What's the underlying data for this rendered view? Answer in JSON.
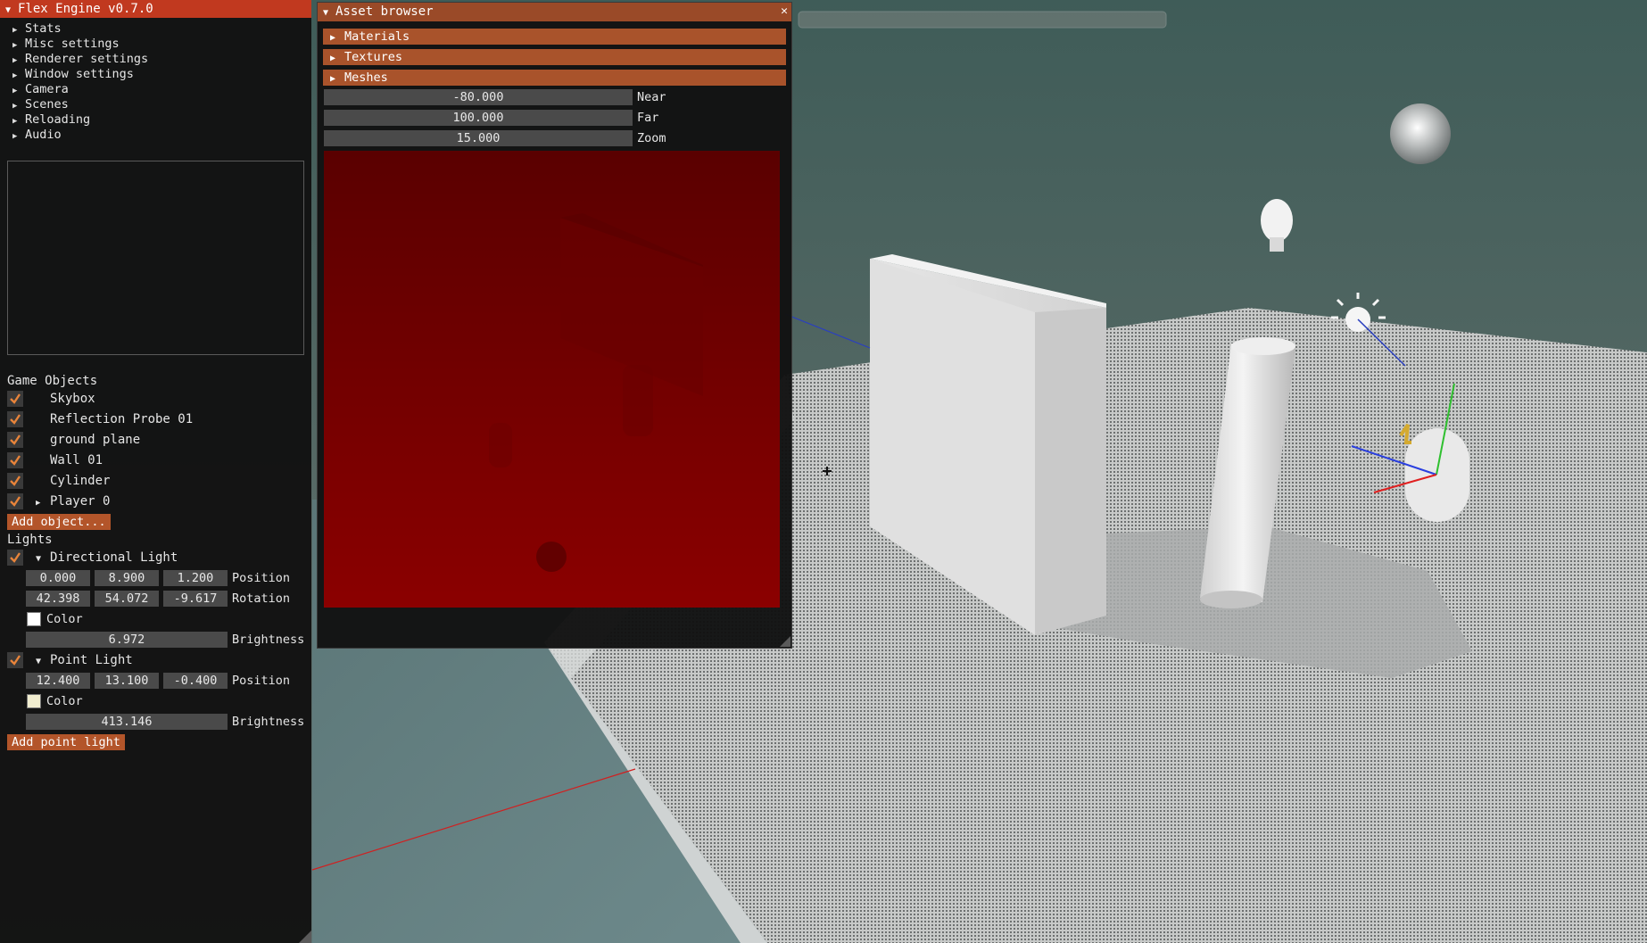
{
  "main_window": {
    "title": "Flex Engine v0.7.0",
    "collapse_arrow": "▼",
    "menu_items": [
      {
        "arrow": "▶",
        "label": "Stats"
      },
      {
        "arrow": "▶",
        "label": "Misc settings"
      },
      {
        "arrow": "▶",
        "label": "Renderer settings"
      },
      {
        "arrow": "▶",
        "label": "Window settings"
      },
      {
        "arrow": "▶",
        "label": "Camera"
      },
      {
        "arrow": "▶",
        "label": "Scenes"
      },
      {
        "arrow": "▶",
        "label": "Reloading"
      },
      {
        "arrow": "▶",
        "label": "Audio"
      }
    ],
    "game_objects_label": "Game Objects",
    "game_objects": [
      {
        "label": "Skybox",
        "checked": true,
        "arrow": ""
      },
      {
        "label": "Reflection Probe 01",
        "checked": true,
        "arrow": ""
      },
      {
        "label": "ground plane",
        "checked": true,
        "arrow": ""
      },
      {
        "label": "Wall 01",
        "checked": true,
        "arrow": ""
      },
      {
        "label": "Cylinder",
        "checked": true,
        "arrow": ""
      },
      {
        "label": "Player 0",
        "checked": true,
        "arrow": "▶"
      }
    ],
    "add_object_label": "Add object...",
    "lights_label": "Lights",
    "directional_light": {
      "arrow": "▼",
      "label": "Directional Light",
      "position": [
        "0.000",
        "8.900",
        "1.200"
      ],
      "position_label": "Position",
      "rotation": [
        "42.398",
        "54.072",
        "-9.617"
      ],
      "rotation_label": "Rotation",
      "color_label": "Color",
      "color": "#ffffff",
      "brightness": "6.972",
      "brightness_label": "Brightness"
    },
    "point_light": {
      "arrow": "▼",
      "label": "Point Light",
      "position": [
        "12.400",
        "13.100",
        "-0.400"
      ],
      "position_label": "Position",
      "color_label": "Color",
      "color": "#f1edcf",
      "brightness": "413.146",
      "brightness_label": "Brightness"
    },
    "add_point_light_label": "Add point light"
  },
  "asset_browser": {
    "title": "Asset browser",
    "collapse_arrow": "▼",
    "close_glyph": "✕",
    "sections": [
      {
        "arrow": "▶",
        "label": "Materials"
      },
      {
        "arrow": "▶",
        "label": "Textures"
      },
      {
        "arrow": "▶",
        "label": "Meshes"
      }
    ],
    "near": {
      "value": "-80.000",
      "label": "Near"
    },
    "far": {
      "value": "100.000",
      "label": "Far"
    },
    "zoom": {
      "value": "15.000",
      "label": "Zoom"
    }
  },
  "colors": {
    "accent": "#b3552a",
    "title_active": "#c1391f",
    "title_inactive": "#9a4a28",
    "checkmark": "#e8843a",
    "shadow_preview": "#8b0000"
  }
}
